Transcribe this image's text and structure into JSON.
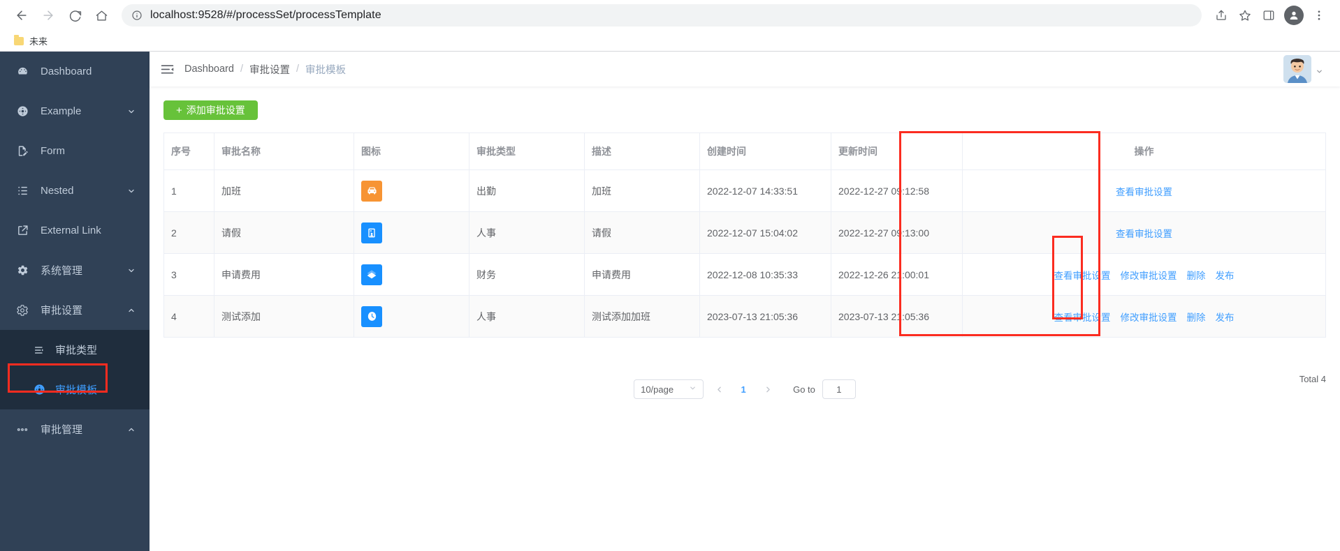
{
  "browser": {
    "url_display": "localhost:9528/#/processSet/processTemplate",
    "back_icon": "back-arrow-icon",
    "forward_icon": "forward-arrow-icon",
    "reload_icon": "reload-icon",
    "home_icon": "home-icon",
    "info_icon": "site-info-icon",
    "share_icon": "share-icon",
    "star_icon": "bookmark-star-icon",
    "sidepanel_icon": "side-panel-icon",
    "profile_icon": "profile-icon",
    "menu_icon": "kebab-menu-icon",
    "bookmark": {
      "label": "未来",
      "icon": "folder-icon"
    }
  },
  "sidebar": {
    "bg_color": "#304156",
    "submenu_bg_color": "#1f2d3d",
    "active_color": "#409eff",
    "items": [
      {
        "label": "Dashboard",
        "icon": "dashboard-icon",
        "has_arrow": false
      },
      {
        "label": "Example",
        "icon": "example-icon",
        "has_arrow": true,
        "arrow": "chevron-down-icon"
      },
      {
        "label": "Form",
        "icon": "form-icon",
        "has_arrow": false
      },
      {
        "label": "Nested",
        "icon": "nested-list-icon",
        "has_arrow": true,
        "arrow": "chevron-down-icon"
      },
      {
        "label": "External Link",
        "icon": "external-link-icon",
        "has_arrow": false
      },
      {
        "label": "系统管理",
        "icon": "gear-icon",
        "has_arrow": true,
        "arrow": "chevron-down-icon"
      },
      {
        "label": "审批设置",
        "icon": "settings-gear-icon",
        "has_arrow": true,
        "arrow": "chevron-up-icon",
        "expanded": true
      }
    ],
    "submenu": [
      {
        "label": "审批类型",
        "icon": "list-icon",
        "active": false
      },
      {
        "label": "审批模板",
        "icon": "template-icon",
        "active": true
      }
    ],
    "trailing_items": [
      {
        "label": "审批管理",
        "icon": "dots-icon",
        "has_arrow": true,
        "arrow": "chevron-up-icon"
      }
    ]
  },
  "navbar": {
    "hamburger_icon": "hamburger-collapse-icon",
    "breadcrumb": [
      {
        "label": "Dashboard",
        "current": false
      },
      {
        "label": "审批设置",
        "current": false
      },
      {
        "label": "审批模板",
        "current": true
      }
    ],
    "separator": "/",
    "avatar_icon": "user-avatar",
    "caret_icon": "caret-down-icon"
  },
  "toolbar": {
    "add_button_label": "添加审批设置",
    "add_button_plus": "+",
    "add_button_color": "#67c23a"
  },
  "table": {
    "columns": [
      {
        "key": "index",
        "label": "序号",
        "align": "left"
      },
      {
        "key": "name",
        "label": "审批名称",
        "align": "left"
      },
      {
        "key": "icon",
        "label": "图标",
        "align": "left"
      },
      {
        "key": "type",
        "label": "审批类型",
        "align": "left"
      },
      {
        "key": "description",
        "label": "描述",
        "align": "left"
      },
      {
        "key": "create_time",
        "label": "创建时间",
        "align": "left"
      },
      {
        "key": "update_time",
        "label": "更新时间",
        "align": "left"
      },
      {
        "key": "operations",
        "label": "操作",
        "align": "center"
      }
    ],
    "rows": [
      {
        "index": "1",
        "name": "加班",
        "icon": {
          "glyph": "car-icon",
          "bg": "#f79433"
        },
        "type": "出勤",
        "description": "加班",
        "create_time": "2022-12-07 14:33:51",
        "update_time": "2022-12-27 09:12:58",
        "operations": [
          "查看审批设置"
        ]
      },
      {
        "index": "2",
        "name": "请假",
        "icon": {
          "glyph": "id-badge-icon",
          "bg": "#1890ff"
        },
        "type": "人事",
        "description": "请假",
        "create_time": "2022-12-07 15:04:02",
        "update_time": "2022-12-27 09:13:00",
        "operations": [
          "查看审批设置"
        ]
      },
      {
        "index": "3",
        "name": "申请费用",
        "icon": {
          "glyph": "money-icon",
          "bg": "#1890ff"
        },
        "type": "财务",
        "description": "申请费用",
        "create_time": "2022-12-08 10:35:33",
        "update_time": "2022-12-26 21:00:01",
        "operations": [
          "查看审批设置",
          "修改审批设置",
          "删除",
          "发布"
        ]
      },
      {
        "index": "4",
        "name": "测试添加",
        "icon": {
          "glyph": "clock-icon",
          "bg": "#1890ff"
        },
        "type": "人事",
        "description": "测试添加加班",
        "create_time": "2023-07-13 21:05:36",
        "update_time": "2023-07-13 21:05:36",
        "operations": [
          "查看审批设置",
          "修改审批设置",
          "删除",
          "发布"
        ]
      }
    ]
  },
  "pagination": {
    "page_size_label": "10/page",
    "page_size_chevron": "chevron-down-icon",
    "prev_icon": "chevron-left-icon",
    "next_icon": "chevron-right-icon",
    "current_page": "1",
    "goto_label": "Go to",
    "goto_value": "1",
    "total_label": "Total 4"
  },
  "annotations": {
    "color": "#fb2c20",
    "boxes": [
      {
        "name": "sidebar-active-item-highlight"
      },
      {
        "name": "operations-column-highlight"
      },
      {
        "name": "publish-links-highlight"
      }
    ]
  }
}
